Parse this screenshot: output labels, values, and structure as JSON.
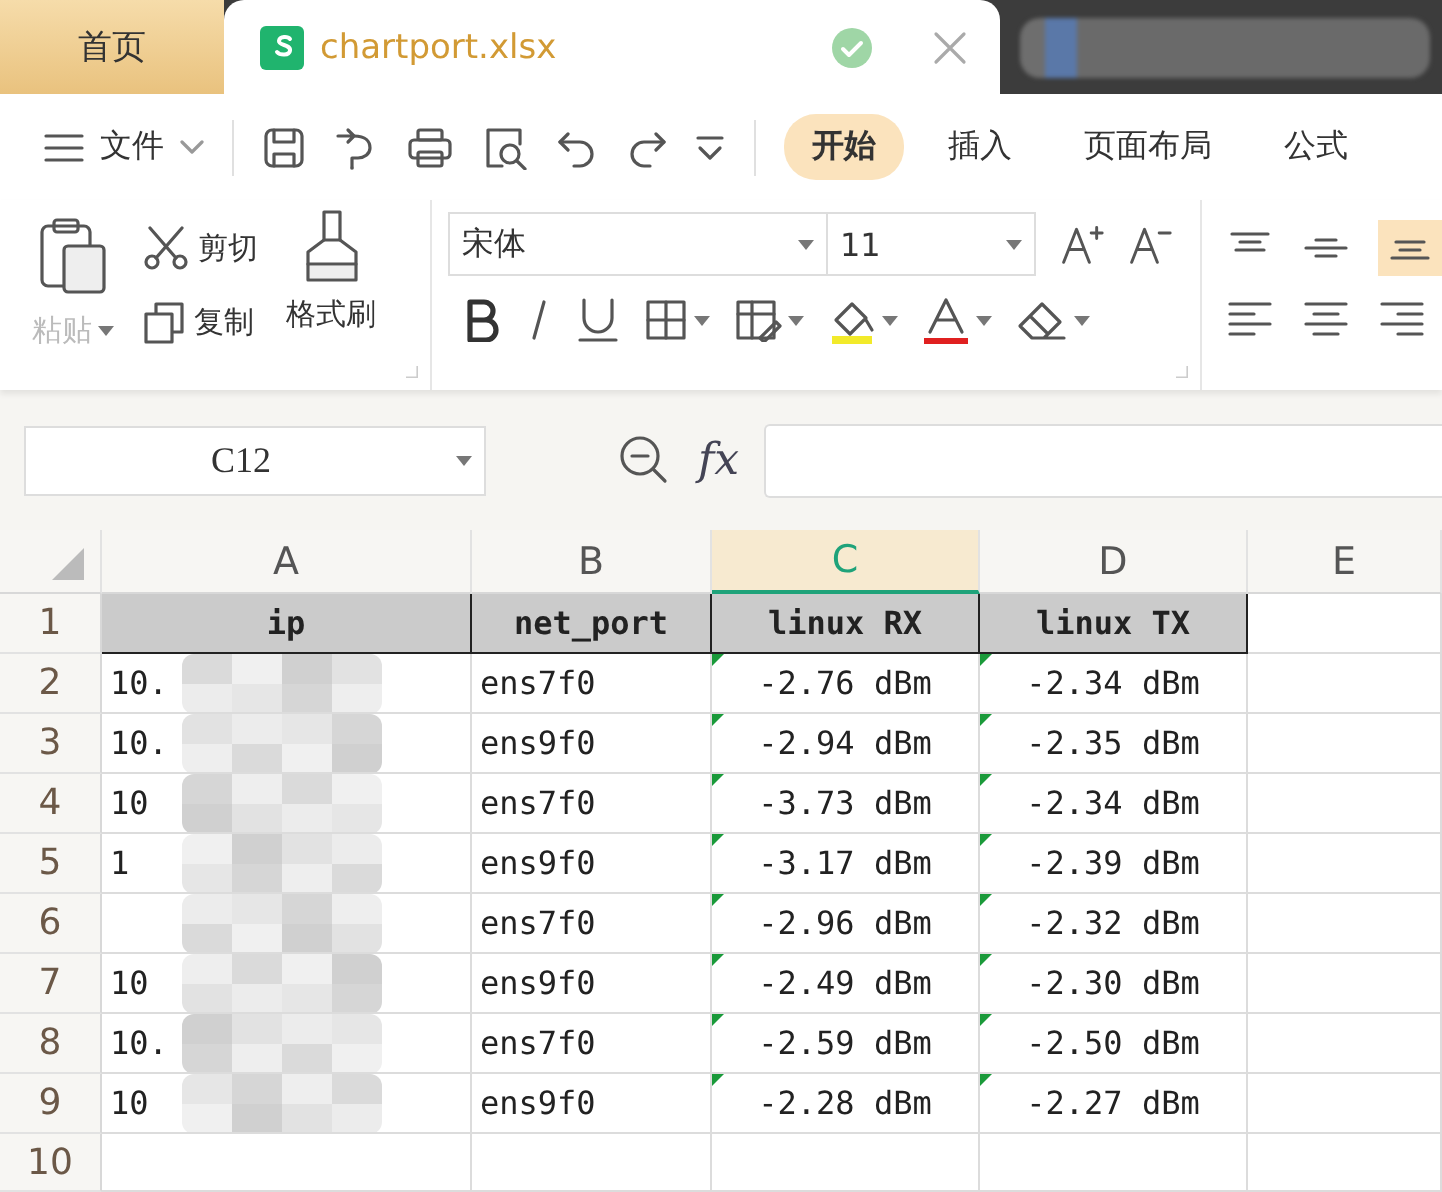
{
  "tabs": [
    {
      "kind": "home",
      "label": "首页",
      "selected": false
    },
    {
      "kind": "file",
      "label": "chartport.xlsx",
      "selected": true,
      "saved": true
    },
    {
      "kind": "blurred",
      "selected": false
    }
  ],
  "menu": {
    "label": "文件"
  },
  "ribbon_tabs": [
    {
      "label": "开始",
      "selected": true
    },
    {
      "label": "插入",
      "selected": false
    },
    {
      "label": "页面布局",
      "selected": false
    },
    {
      "label": "公式",
      "selected": false
    }
  ],
  "clipboard": {
    "paste": {
      "label": "粘贴",
      "disabled": true
    },
    "cut": "剪切",
    "copy": "复制",
    "format_painter": "格式刷"
  },
  "font": {
    "name": "宋体",
    "size": "11"
  },
  "name_box": "C12",
  "formula_label": "fx",
  "sheet": {
    "columns": [
      {
        "label": "A",
        "selected": false
      },
      {
        "label": "B",
        "selected": false
      },
      {
        "label": "C",
        "selected": true
      },
      {
        "label": "D",
        "selected": false
      },
      {
        "label": "E",
        "selected": false
      }
    ],
    "rows": [
      {
        "number": "1",
        "kind": "header",
        "cells": [
          {
            "text": "ip",
            "redacted": false,
            "flagged": false
          },
          {
            "text": "net_port",
            "flagged": false
          },
          {
            "text": "linux RX",
            "flagged": false
          },
          {
            "text": "linux TX",
            "flagged": false
          }
        ]
      },
      {
        "number": "2",
        "kind": "data",
        "cells": [
          {
            "text": "10.",
            "redacted": true,
            "flagged": false
          },
          {
            "text": "ens7f0",
            "flagged": false
          },
          {
            "text": "-2.76 dBm",
            "flagged": true
          },
          {
            "text": "-2.34 dBm",
            "flagged": true
          }
        ]
      },
      {
        "number": "3",
        "kind": "data",
        "cells": [
          {
            "text": "10.",
            "redacted": true,
            "flagged": false
          },
          {
            "text": "ens9f0",
            "flagged": false
          },
          {
            "text": "-2.94 dBm",
            "flagged": true
          },
          {
            "text": "-2.35 dBm",
            "flagged": true
          }
        ]
      },
      {
        "number": "4",
        "kind": "data",
        "cells": [
          {
            "text": "10",
            "redacted": true,
            "flagged": false
          },
          {
            "text": "ens7f0",
            "flagged": false
          },
          {
            "text": "-3.73 dBm",
            "flagged": true
          },
          {
            "text": "-2.34 dBm",
            "flagged": true
          }
        ]
      },
      {
        "number": "5",
        "kind": "data",
        "cells": [
          {
            "text": "1",
            "redacted": true,
            "flagged": false
          },
          {
            "text": "ens9f0",
            "flagged": false
          },
          {
            "text": "-3.17 dBm",
            "flagged": true
          },
          {
            "text": "-2.39 dBm",
            "flagged": true
          }
        ]
      },
      {
        "number": "6",
        "kind": "data",
        "cells": [
          {
            "redacted": true,
            "flagged": false
          },
          {
            "text": "ens7f0",
            "flagged": false
          },
          {
            "text": "-2.96 dBm",
            "flagged": true
          },
          {
            "text": "-2.32 dBm",
            "flagged": true
          }
        ]
      },
      {
        "number": "7",
        "kind": "data",
        "cells": [
          {
            "text": "10",
            "redacted": true,
            "flagged": false
          },
          {
            "text": "ens9f0",
            "flagged": false
          },
          {
            "text": "-2.49 dBm",
            "flagged": true
          },
          {
            "text": "-2.30 dBm",
            "flagged": true
          }
        ]
      },
      {
        "number": "8",
        "kind": "data",
        "cells": [
          {
            "text": "10.",
            "redacted": true,
            "flagged": false
          },
          {
            "text": "ens7f0",
            "flagged": false
          },
          {
            "text": "-2.59 dBm",
            "flagged": true
          },
          {
            "text": "-2.50 dBm",
            "flagged": true
          }
        ]
      },
      {
        "number": "9",
        "kind": "data",
        "cells": [
          {
            "text": "10",
            "redacted": true,
            "flagged": false
          },
          {
            "text": "ens9f0",
            "flagged": false
          },
          {
            "text": "-2.28 dBm",
            "flagged": true
          },
          {
            "text": "-2.27 dBm",
            "flagged": true
          }
        ]
      },
      {
        "number": "10",
        "kind": "data",
        "cells": []
      }
    ]
  }
}
